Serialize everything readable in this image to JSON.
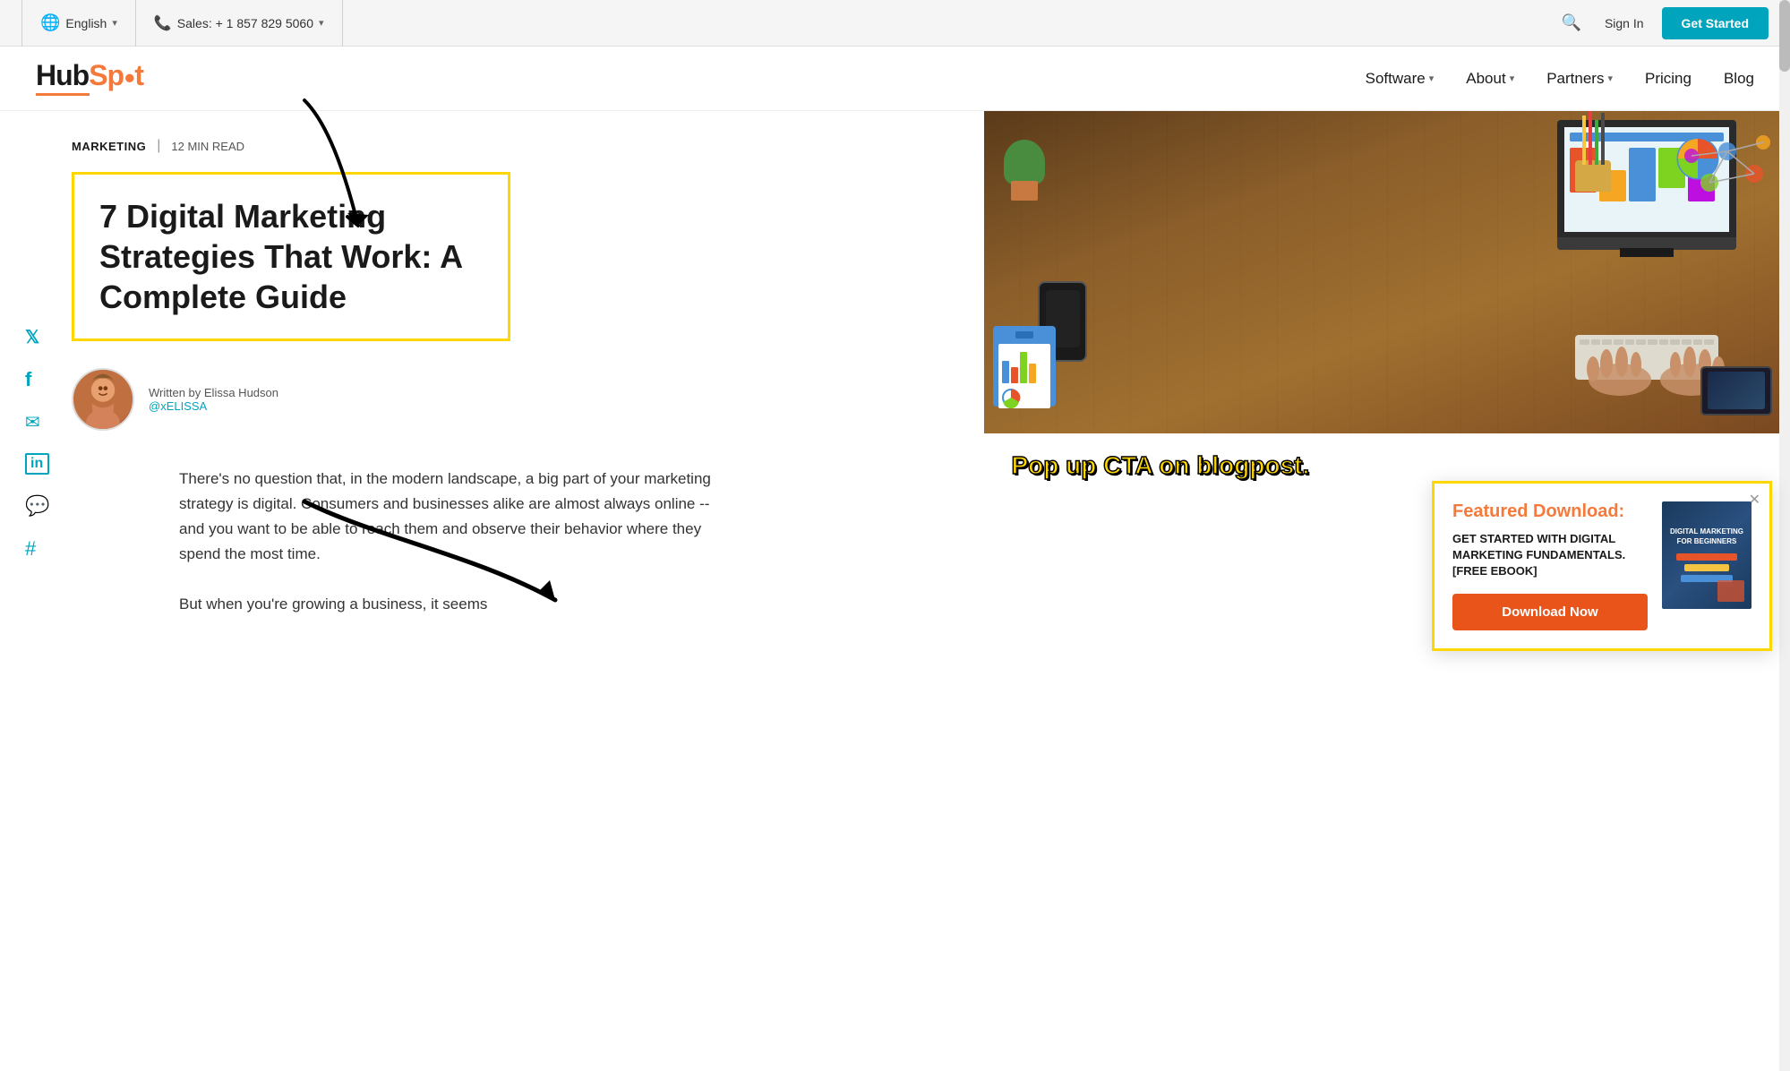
{
  "topbar": {
    "language": "English",
    "language_icon": "🌐",
    "phone_icon": "📞",
    "sales_label": "Sales: + 1 857 829 5060",
    "search_label": "Search",
    "signin_label": "Sign In",
    "get_started_label": "Get Started"
  },
  "nav": {
    "logo_hub": "Hub",
    "logo_spot": "Sp",
    "logo_dot": "●",
    "logo_t": "t",
    "software_label": "Software",
    "about_label": "About",
    "partners_label": "Partners",
    "pricing_label": "Pricing",
    "blog_label": "Blog"
  },
  "article": {
    "category": "MARKETING",
    "read_time": "12 MIN READ",
    "title": "7 Digital Marketing Strategies That Work: A Complete Guide",
    "written_by": "Written by Elissa Hudson",
    "author_name": "Elissa Hudson",
    "author_handle": "@xELISSA",
    "body_p1": "There's no question that, in the modern landscape, a big part of your marketing strategy is digital. Consumers and businesses alike are almost always online -- and you want to be able to reach them and observe their behavior where they spend the most time.",
    "body_p2": "But when you're growing a business, it seems"
  },
  "social": {
    "twitter": "𝕏",
    "facebook": "f",
    "email": "✉",
    "linkedin": "in",
    "messenger": "⊛",
    "hashtag": "#"
  },
  "popup": {
    "annotation_text": "Pop up CTA on blogpost.",
    "close_label": "✕",
    "featured_label": "Featured Download:",
    "description": "GET STARTED WITH DIGITAL MARKETING FUNDAMENTALS. [FREE EBOOK]",
    "download_label": "Download Now",
    "ebook_title": "DIGITAL MARKETING FOR BEGINNERS"
  },
  "colors": {
    "accent_orange": "#f5793a",
    "accent_teal": "#00a4bd",
    "accent_yellow": "#ffd700",
    "cta_orange": "#e8541a"
  }
}
